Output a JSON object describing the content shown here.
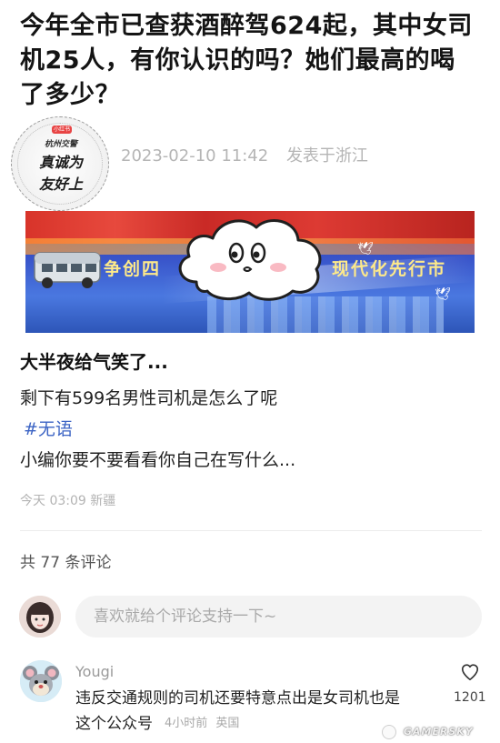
{
  "article": {
    "title": "今年全市已查获酒醉驾624起，其中女司机25人，有你认识的吗？她们最高的喝了多少？",
    "date": "2023-02-10 11:42",
    "location": "发表于浙江",
    "stamp": {
      "tag": "小红书",
      "line1": "杭州交警",
      "line2": "真诚为",
      "line3": "友好上"
    },
    "banner": {
      "text_left": "争创四",
      "text_right": "现代化先行市"
    }
  },
  "post": {
    "heading": "大半夜给气笑了...",
    "line1": "剩下有599名男性司机是怎么了呢",
    "tag": "#无语",
    "line2": "小编你要不要看看你自己在写什么...",
    "meta": "今天 03:09 新疆"
  },
  "comments": {
    "count_label": "共 77 条评论",
    "input_placeholder": "喜欢就给个评论支持一下~",
    "items": [
      {
        "author": "Yougi",
        "text_line1": "违反交通规则的司机还要特意点出是女司机也是",
        "text_line2": "这个公众号",
        "time": "4小时前",
        "location": "英国",
        "likes": "1201"
      }
    ]
  },
  "watermark": "GAMERSKY",
  "colors": {
    "tag_blue": "#3b63c4",
    "meta_gray": "#b5b5b5",
    "input_bg": "#f3f3f3"
  }
}
